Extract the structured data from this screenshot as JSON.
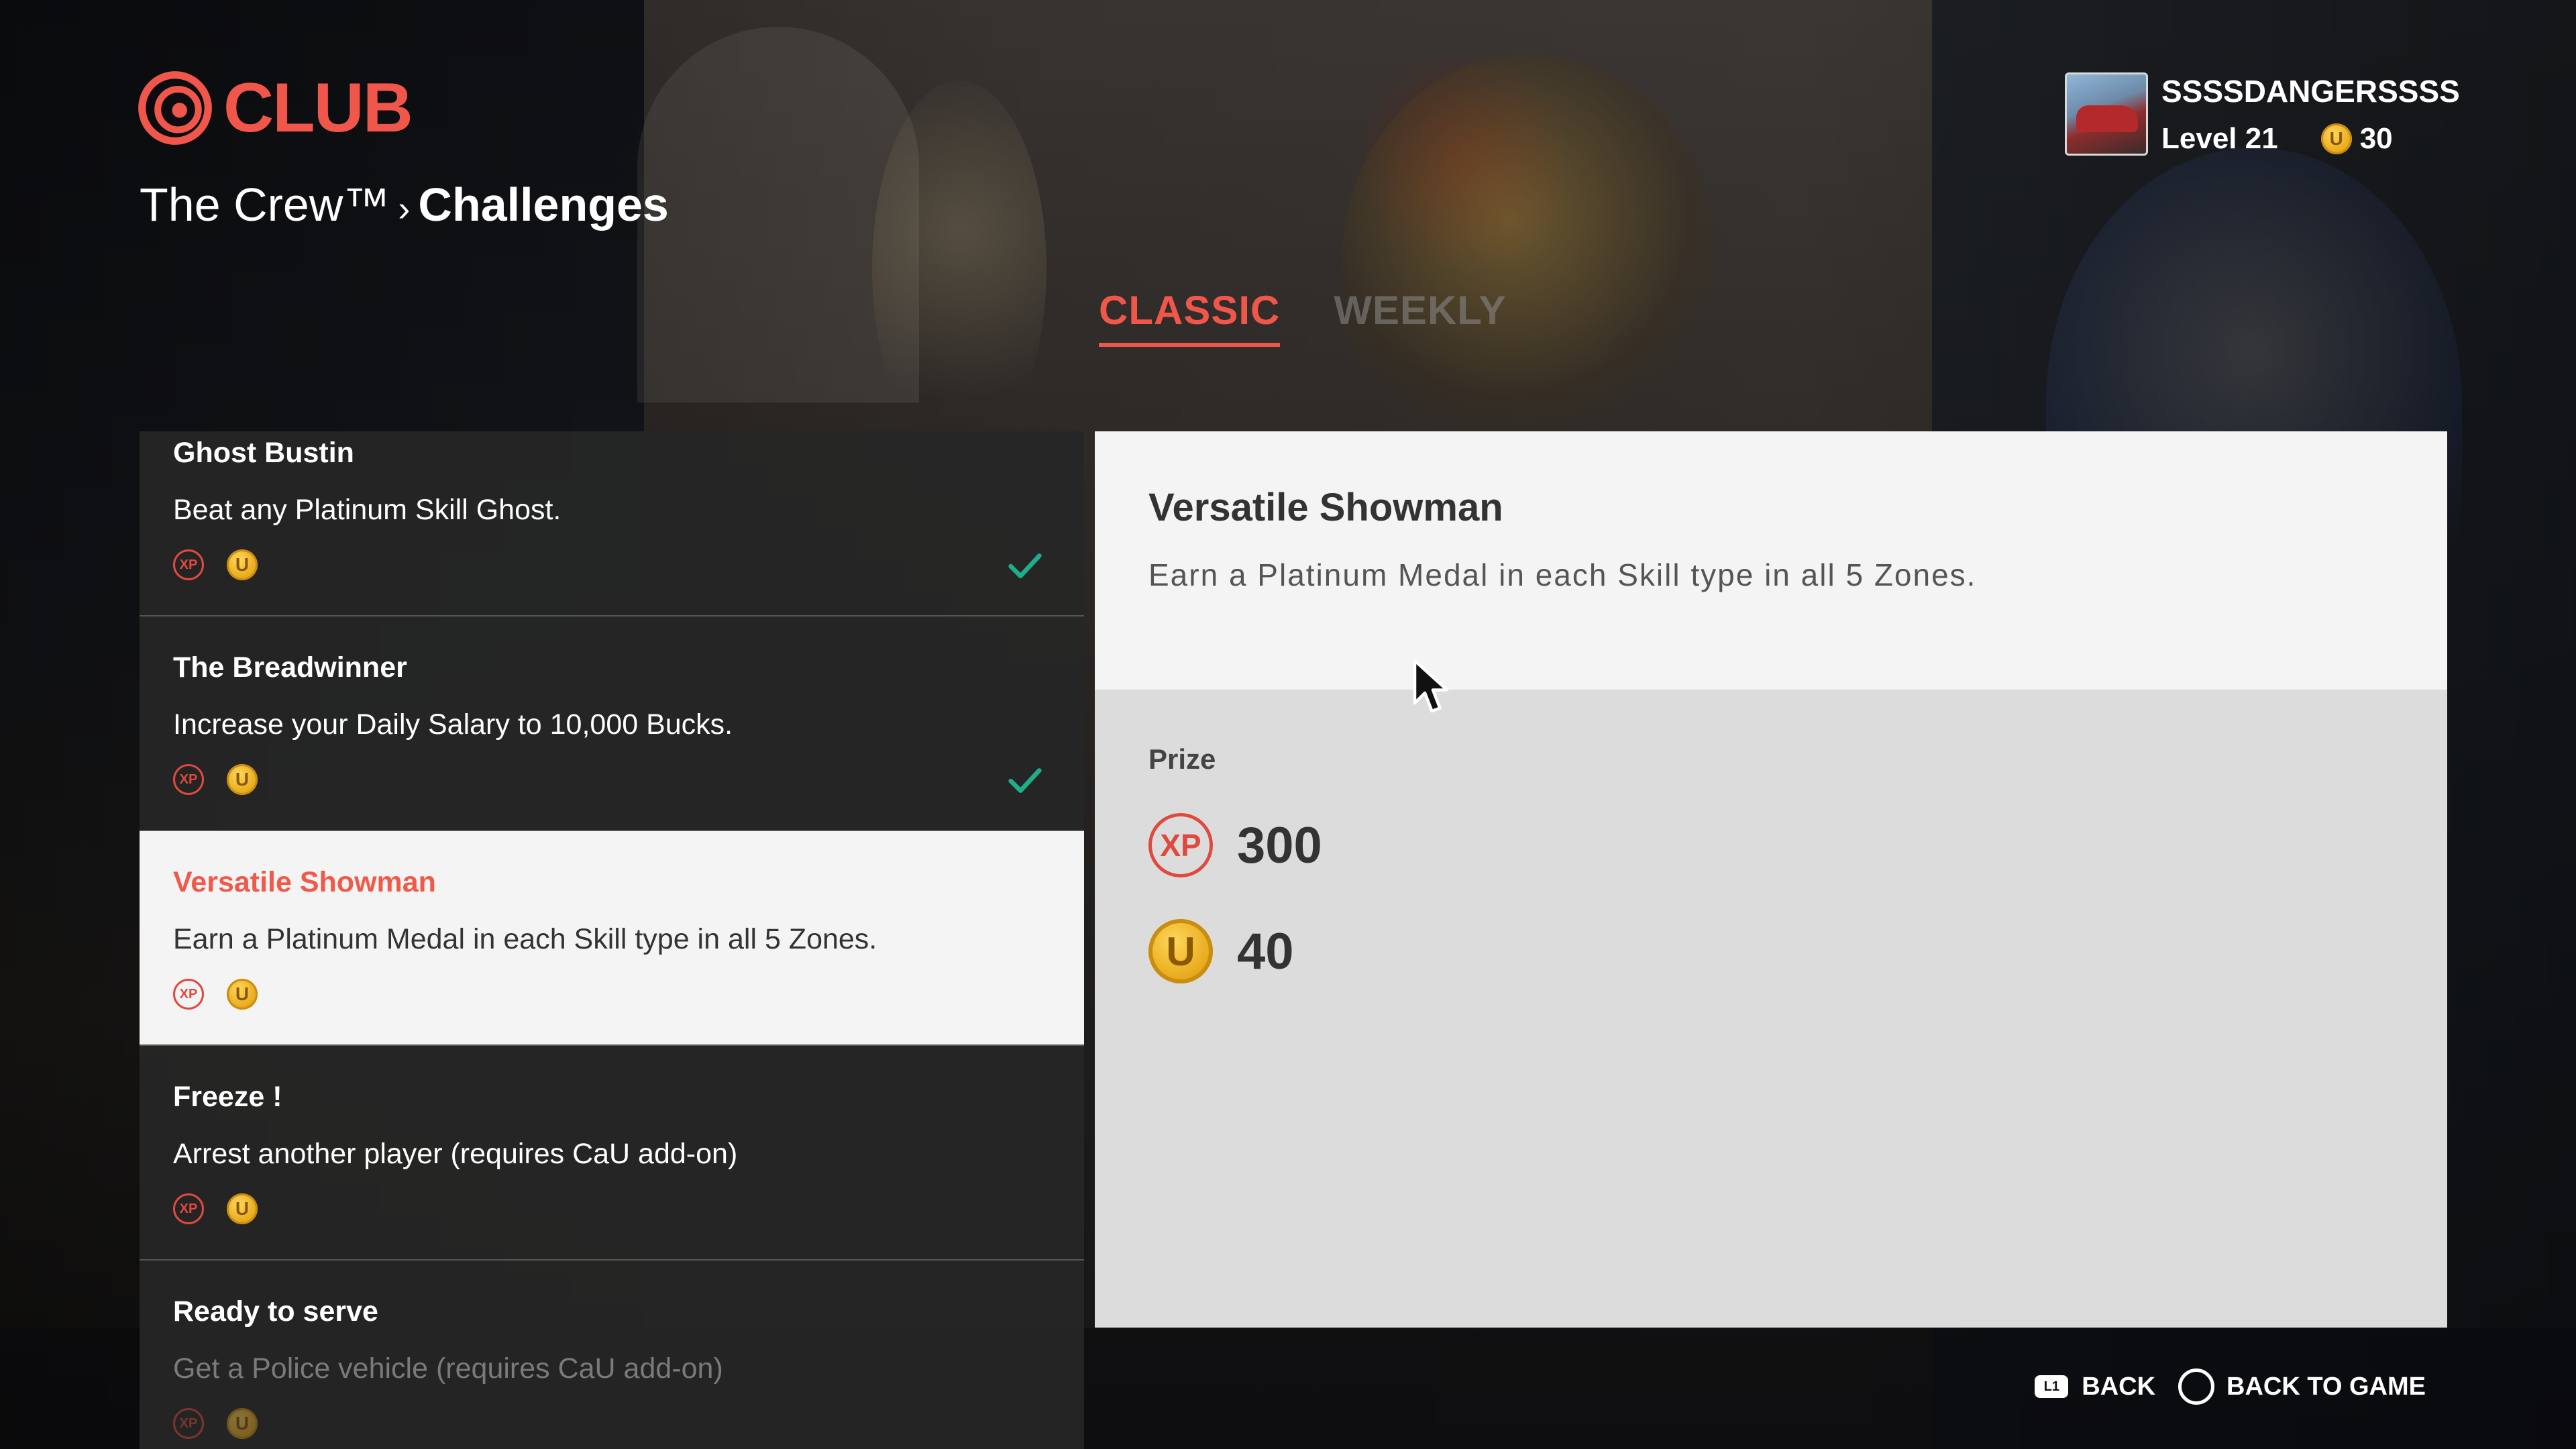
{
  "header": {
    "logo_text": "CLUB",
    "breadcrumb": {
      "parent": "The Crew™",
      "separator": "›",
      "current": "Challenges"
    }
  },
  "profile": {
    "username": "SSSSDANGERSSSS",
    "level": "Level 21",
    "coins": "30"
  },
  "tabs": [
    {
      "label": "CLASSIC",
      "active": true
    },
    {
      "label": "WEEKLY",
      "active": false
    }
  ],
  "challenges": [
    {
      "title": "Ghost Bustin",
      "description": "Beat any Platinum Skill Ghost.",
      "completed": true
    },
    {
      "title": "The Breadwinner",
      "description": "Increase your Daily Salary to 10,000 Bucks.",
      "completed": true
    },
    {
      "title": "Versatile Showman",
      "description": "Earn a Platinum Medal in each Skill type in all 5 Zones.",
      "completed": false,
      "selected": true
    },
    {
      "title": "Freeze !",
      "description": "Arrest another player (requires CaU add-on)",
      "completed": false
    },
    {
      "title": "Ready to serve",
      "description": "Get a Police vehicle (requires CaU add-on)",
      "completed": false
    }
  ],
  "icons": {
    "xp_label": "XP",
    "coin_label": "U"
  },
  "detail": {
    "title": "Versatile Showman",
    "description": "Earn a Platinum Medal in each Skill type in all 5 Zones.",
    "prize_label": "Prize",
    "xp_value": "300",
    "coin_value": "40"
  },
  "footer": {
    "back_button_glyph": "L1",
    "back_label": "BACK",
    "back_to_game_label": "BACK TO GAME"
  },
  "colors": {
    "accent": "#f0564a",
    "check": "#1fae8a",
    "coin": "#e6a717"
  }
}
